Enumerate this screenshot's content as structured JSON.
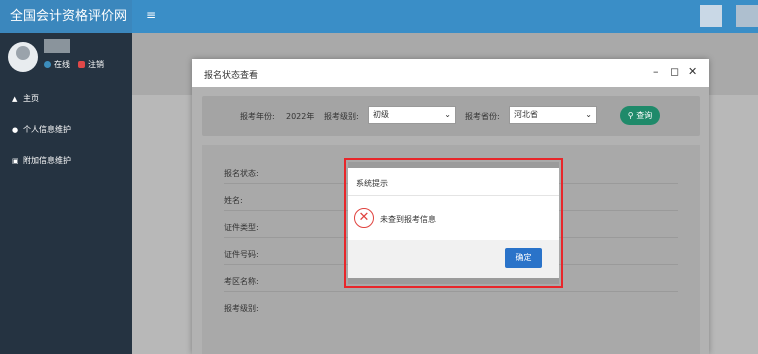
{
  "header": {
    "brand": "全国会计资格评价网",
    "menu_icon": "hamburger-icon"
  },
  "sidebar": {
    "status_online": "在线",
    "status_logout": "注销",
    "items": [
      {
        "label": "主页",
        "icon": "home-icon"
      },
      {
        "label": "个人信息维护",
        "icon": "user-icon"
      },
      {
        "label": "附加信息维护",
        "icon": "id-card-icon"
      }
    ]
  },
  "modal": {
    "title": "报名状态查看",
    "search": {
      "year_label": "报考年份:",
      "year_value": "2022年",
      "level_label": "报考级别:",
      "level_value": "初级",
      "province_label": "报考省份:",
      "province_value": "河北省",
      "query_label": "查询"
    },
    "fields": [
      {
        "label": "报名状态:"
      },
      {
        "label": "姓名:"
      },
      {
        "label": "证件类型:"
      },
      {
        "label": "证件号码:"
      },
      {
        "label": "考区名称:"
      },
      {
        "label": "报考级别:"
      }
    ]
  },
  "dialog": {
    "title": "系统提示",
    "message": "未查到报考信息",
    "ok_label": "确定",
    "highlight_color": "#e8262a"
  }
}
